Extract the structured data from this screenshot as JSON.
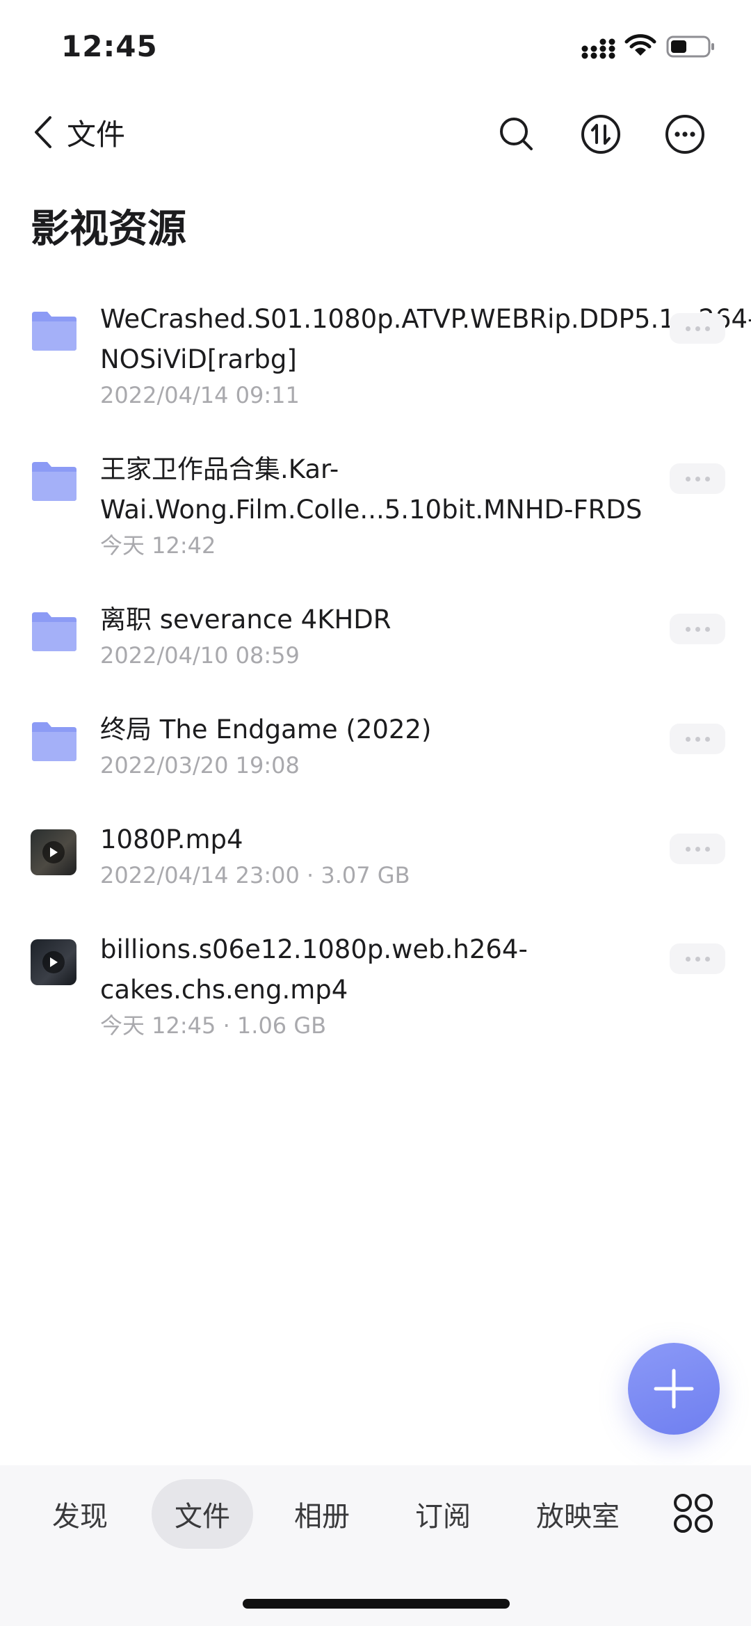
{
  "status_bar": {
    "time": "12:45"
  },
  "nav": {
    "back_label": "文件"
  },
  "page_title": "影视资源",
  "files": [
    {
      "type": "folder",
      "name": "WeCrashed.S01.1080p.ATVP.WEBRip.DDP5.1.x264-NOSiViD[rarbg]",
      "meta": "2022/04/14 09:11"
    },
    {
      "type": "folder",
      "name": "王家卫作品合集.Kar-Wai.Wong.Film.Colle...5.10bit.MNHD-FRDS",
      "meta": "今天 12:42"
    },
    {
      "type": "folder",
      "name": "离职 severance 4KHDR",
      "meta": "2022/04/10 08:59"
    },
    {
      "type": "folder",
      "name": "终局 The Endgame (2022)",
      "meta": "2022/03/20 19:08"
    },
    {
      "type": "video",
      "name": "1080P.mp4",
      "meta": "2022/04/14 23:00 · 3.07 GB"
    },
    {
      "type": "video",
      "name": "billions.s06e12.1080p.web.h264-cakes.chs.eng.mp4",
      "meta": "今天 12:45 · 1.06 GB"
    }
  ],
  "tabs": [
    {
      "label": "发现",
      "active": false
    },
    {
      "label": "文件",
      "active": true
    },
    {
      "label": "相册",
      "active": false
    },
    {
      "label": "订阅",
      "active": false
    },
    {
      "label": "放映室",
      "active": false
    }
  ],
  "icons": {
    "folder": "folder-icon",
    "video": "video-thumbnail",
    "search": "search-icon",
    "sort": "sort-icon",
    "more": "more-icon",
    "apps": "apps-grid-icon",
    "add": "plus-icon"
  },
  "colors": {
    "accent": "#7784F0",
    "folder": "#8C9BF5",
    "secondary_text": "#A9A9AD"
  }
}
